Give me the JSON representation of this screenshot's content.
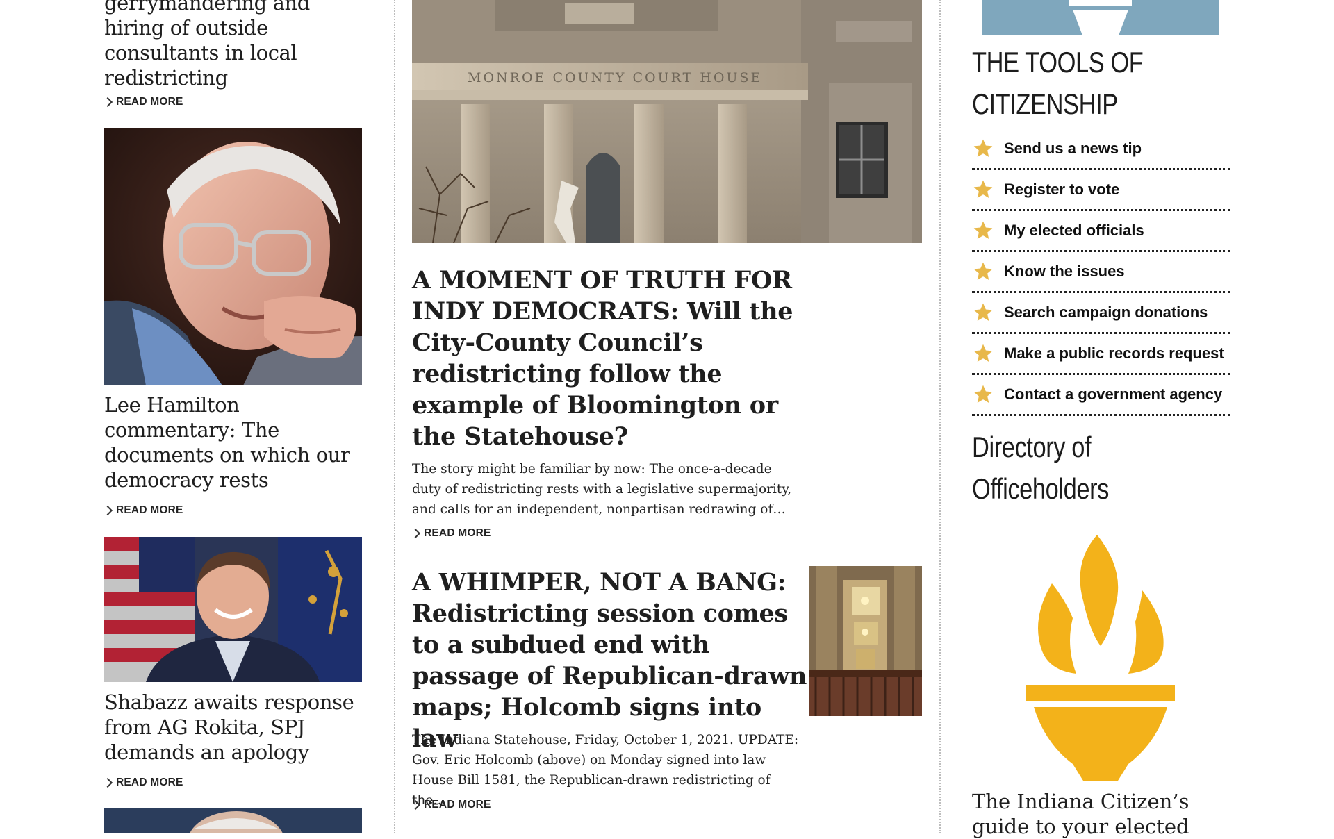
{
  "left_column": {
    "articles": [
      {
        "title": "gerrymandering and hiring of outside consultants in local redistricting",
        "read_more": "READ MORE",
        "image_alt": "",
        "has_image": false
      },
      {
        "title": "Lee Hamilton commentary: The documents on which our democracy rests",
        "read_more": "READ MORE"
      },
      {
        "title": "Shabazz awaits response from AG Rokita, SPJ demands an apology",
        "read_more": "READ MORE"
      }
    ]
  },
  "main_column": {
    "articles": [
      {
        "title": "A MOMENT OF TRUTH FOR INDY DEMOCRATS: Will the City-County Council’s redistricting follow the example of Bloomington or the Statehouse?",
        "excerpt": "The story might be familiar by now: The once-a-decade duty of redistricting rests with a legislative supermajority, and calls for an independent, nonpartisan redrawing of…",
        "read_more": "READ MORE",
        "image_caption": "MONROE COUNTY COURT HOUSE"
      },
      {
        "title": "A WHIMPER, NOT A BANG: Redistricting session comes to a subdued end with passage of Republican-drawn maps; Holcomb signs into law",
        "excerpt": "The Indiana Statehouse, Friday, October 1, 2021. UPDATE: Gov. Eric Holcomb (above) on Monday signed into law House Bill 1581, the Republican-drawn redistricting of the…",
        "read_more": "READ MORE"
      }
    ]
  },
  "sidebar": {
    "tools_title_line1": "THE TOOLS OF",
    "tools_title_line2": "CITIZENSHIP",
    "tools": [
      {
        "label": "Send us a news tip"
      },
      {
        "label": "Register to vote"
      },
      {
        "label": "My elected officials"
      },
      {
        "label": "Know the issues"
      },
      {
        "label": "Search campaign donations"
      },
      {
        "label": "Make a public records request"
      },
      {
        "label": "Contact a government agency"
      }
    ],
    "directory_line1": "Directory of",
    "directory_line2": "Officeholders",
    "guide_text": "The Indiana Citizen’s guide to your elected"
  },
  "colors": {
    "star": "#e8b84a",
    "torch": "#f3b21a",
    "banner": "#7fa7bd",
    "divider": "#bdbdbd"
  },
  "icons": {
    "read_more": "chevron-right-icon",
    "tool_item": "star-icon",
    "directory": "torch-icon"
  }
}
